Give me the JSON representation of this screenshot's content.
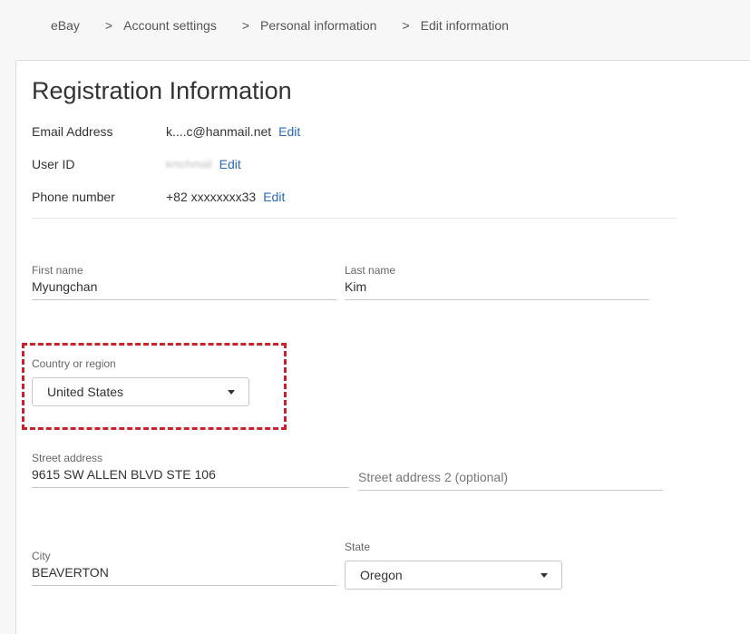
{
  "breadcrumb": {
    "items": [
      "eBay",
      "Account settings",
      "Personal information",
      "Edit information"
    ],
    "separator": ">"
  },
  "page_title": "Registration Information",
  "account": {
    "email": {
      "label": "Email Address",
      "value": "k....c@hanmail.net",
      "edit": "Edit"
    },
    "user_id": {
      "label": "User ID",
      "value": "kmchmail",
      "edit": "Edit"
    },
    "phone": {
      "label": "Phone number",
      "value": "+82 xxxxxxxx33",
      "edit": "Edit"
    }
  },
  "form": {
    "first_name": {
      "label": "First name",
      "value": "Myungchan"
    },
    "last_name": {
      "label": "Last name",
      "value": "Kim"
    },
    "country": {
      "label": "Country or region",
      "value": "United States"
    },
    "street": {
      "label": "Street address",
      "value": "9615 SW ALLEN BLVD STE 106"
    },
    "street2": {
      "placeholder": "Street address 2 (optional)"
    },
    "city": {
      "label": "City",
      "value": "BEAVERTON"
    },
    "state": {
      "label": "State",
      "value": "Oregon"
    }
  },
  "colors": {
    "link": "#2a6bb3",
    "highlight": "#c8232c"
  },
  "icons": {
    "dropdown": "caret-down-icon"
  }
}
